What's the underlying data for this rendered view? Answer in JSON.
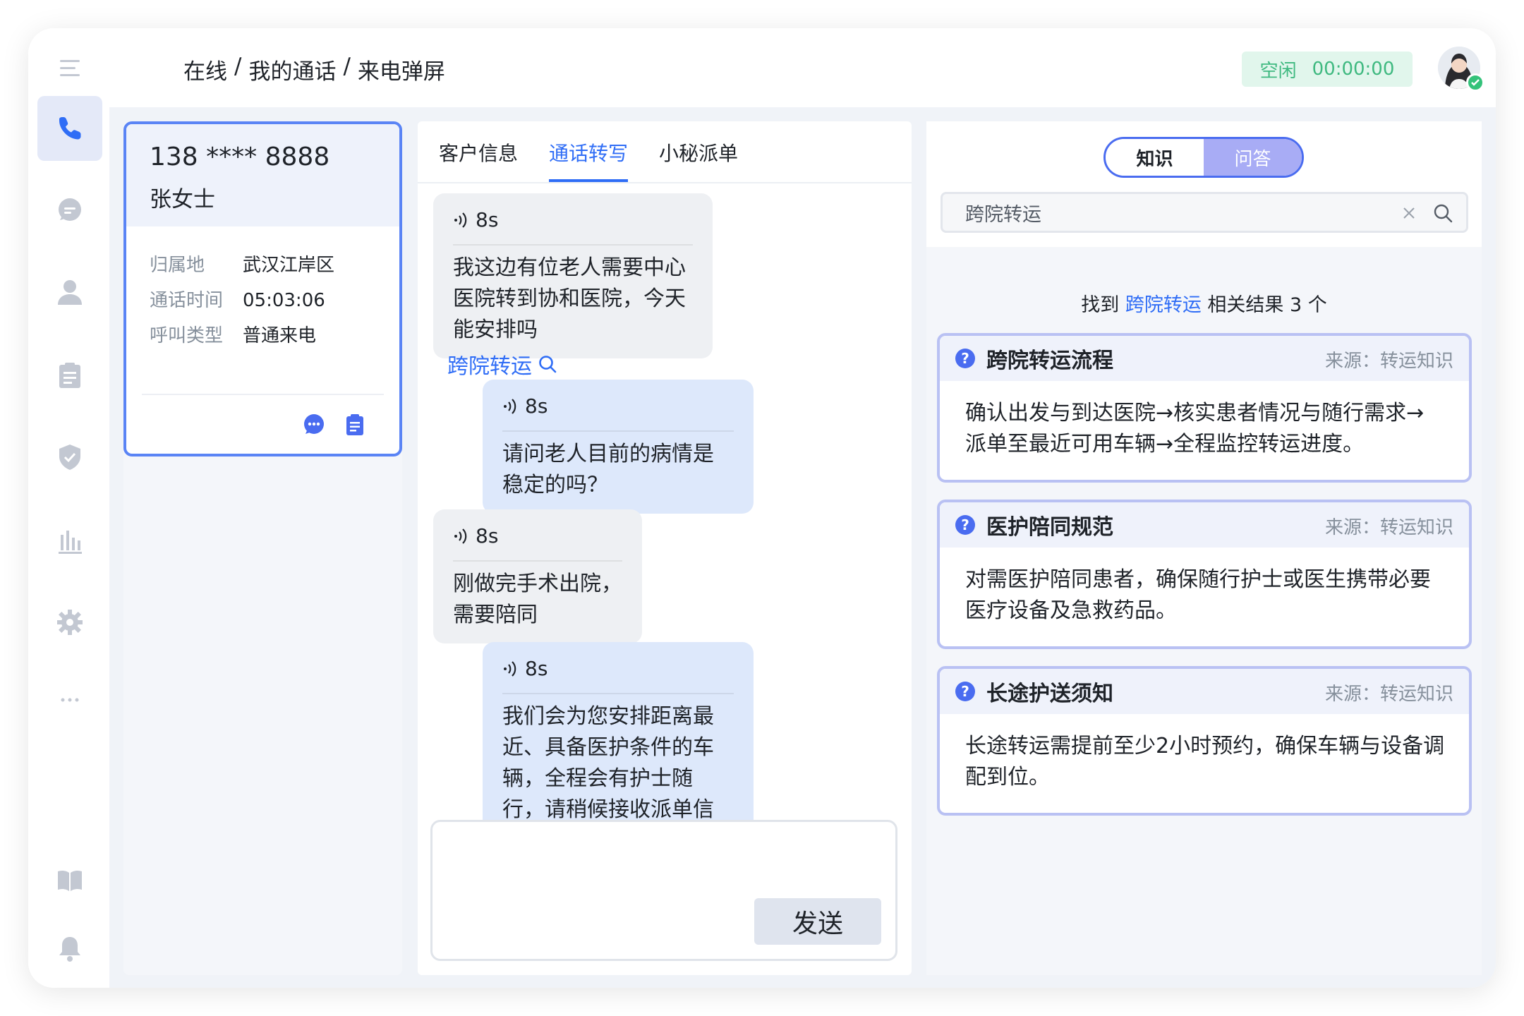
{
  "breadcrumb": {
    "part1": "在线",
    "sep1": "/",
    "part2": "我的通话",
    "sep2": "/",
    "part3": "来电弹屏"
  },
  "status": {
    "state": "空闲",
    "timer": "00:00:00",
    "color": "#3fb980"
  },
  "sidebar": {
    "items": [
      {
        "icon": "menu-icon"
      },
      {
        "icon": "phone-icon",
        "active": true
      },
      {
        "icon": "chat-icon"
      },
      {
        "icon": "user-icon"
      },
      {
        "icon": "clipboard-icon"
      },
      {
        "icon": "shield-icon"
      },
      {
        "icon": "bar-chart-icon"
      },
      {
        "icon": "gear-icon"
      },
      {
        "icon": "more-icon"
      },
      {
        "icon": "book-icon"
      },
      {
        "icon": "bell-icon"
      }
    ]
  },
  "caller": {
    "phone": "138 **** 8888",
    "name": "张女士",
    "rows": [
      {
        "label": "归属地",
        "value": "武汉江岸区"
      },
      {
        "label": "通话时间",
        "value": "05:03:06"
      },
      {
        "label": "呼叫类型",
        "value": "普通来电"
      }
    ]
  },
  "tabs": {
    "customer": "客户信息",
    "transcript": "通话转写",
    "dispatch": "小秘派单"
  },
  "messages": [
    {
      "side": "left",
      "duration": "8s",
      "text": "我这边有位老人需要中心医院转到协和医院，今天能安排吗"
    },
    {
      "side": "right",
      "duration": "8s",
      "text": "请问老人目前的病情是稳定的吗？"
    },
    {
      "side": "left",
      "duration": "8s",
      "text": "刚做完手术出院，需要陪同"
    },
    {
      "side": "right",
      "duration": "8s",
      "text": "我们会为您安排距离最近、具备医护条件的车辆，全程会有护士随行，请稍候接收派单信息"
    }
  ],
  "keyword_link": "跨院转运",
  "send_label": "发送",
  "knowledge": {
    "toggle": {
      "on": "知识",
      "off": "问答"
    },
    "search_value": "跨院转运",
    "result": {
      "prefix": "找到",
      "keyword": "跨院转运",
      "suffix": "相关结果 3 个"
    },
    "cards": [
      {
        "title": "跨院转运流程",
        "source": "来源：转运知识",
        "body": "确认出发与到达医院→核实患者情况与随行需求→ 派单至最近可用车辆→全程监控转运进度。"
      },
      {
        "title": "医护陪同规范",
        "source": "来源：转运知识",
        "body": "对需医护陪同患者，确保随行护士或医生携带必要医疗设备及急救药品。"
      },
      {
        "title": "长途护送须知",
        "source": "来源：转运知识",
        "body": "长途转运需提前至少2小时预约，确保车辆与设备调配到位。"
      }
    ]
  },
  "colors": {
    "accent": "#2f6df6",
    "sidebar_icon": "#c3c8d2",
    "card_border": "#b9c1f3"
  }
}
